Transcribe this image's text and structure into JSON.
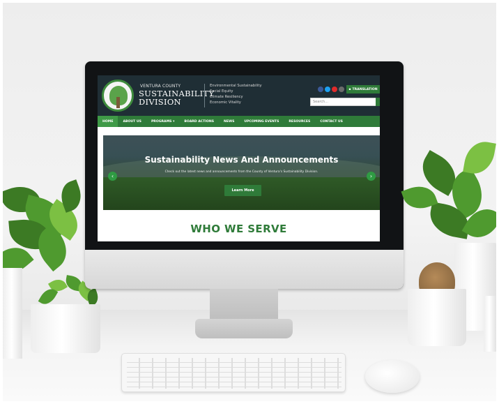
{
  "site": {
    "brand": {
      "county": "VENTURA COUNTY",
      "line1": "SUSTAINABILITY",
      "line2": "DIVISION"
    },
    "pillars": [
      "Environmental Sustainability",
      "Social Equity",
      "Climate Resiliency",
      "Economic Vitality"
    ],
    "translation_label": "TRANSLATION",
    "search_placeholder": "Search...",
    "nav": [
      {
        "label": "HOME",
        "active": true
      },
      {
        "label": "ABOUT US",
        "active": false
      },
      {
        "label": "PROGRAMS ▾",
        "active": false
      },
      {
        "label": "BOARD ACTIONS",
        "active": false
      },
      {
        "label": "NEWS",
        "active": false
      },
      {
        "label": "UPCOMING EVENTS",
        "active": false
      },
      {
        "label": "RESOURCES",
        "active": false
      },
      {
        "label": "CONTACT US",
        "active": false
      }
    ],
    "hero": {
      "title": "Sustainability News And Announcements",
      "subtitle": "Check out the latest news and announcements from the County of Ventura's Sustainability Division.",
      "button": "Learn More"
    },
    "section_heading": "WHO WE SERVE"
  },
  "colors": {
    "header_bg": "#1f2e35",
    "brand_green": "#2f7b39",
    "accent_green": "#2f9c43"
  },
  "icons": {
    "social": [
      "facebook-icon",
      "twitter-icon",
      "youtube-icon",
      "instagram-icon"
    ],
    "prev": "chevron-left-icon",
    "next": "chevron-right-icon",
    "search": "search-icon"
  }
}
